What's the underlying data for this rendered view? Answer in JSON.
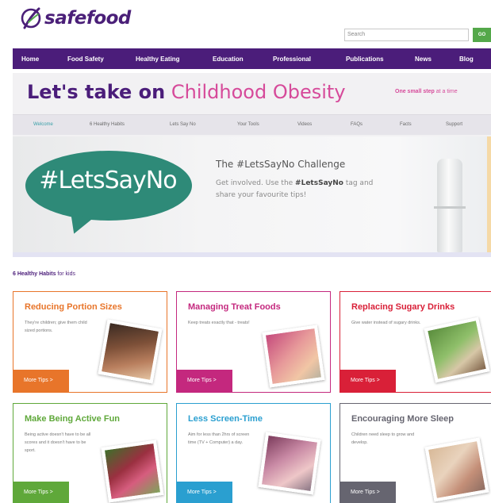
{
  "brand": {
    "name": "safefood"
  },
  "search": {
    "placeholder": "Search",
    "button_label": "GO"
  },
  "nav": {
    "items": [
      {
        "label": "Home"
      },
      {
        "label": "Food Safety"
      },
      {
        "label": "Healthy Eating"
      },
      {
        "label": "Education"
      },
      {
        "label": "Professional"
      },
      {
        "label": "Publications"
      },
      {
        "label": "News"
      },
      {
        "label": "Blog"
      }
    ]
  },
  "campaign": {
    "headline_bold": "Let's take on",
    "headline_accent": "Childhood Obesity",
    "tagline_bold": "One small step",
    "tagline_rest": " at a time"
  },
  "subtabs": [
    {
      "label": "Welcome",
      "active": true
    },
    {
      "label": "6 Healthy Habits"
    },
    {
      "label": "Lets Say No"
    },
    {
      "label": "Your Tools"
    },
    {
      "label": "Videos"
    },
    {
      "label": "FAQs"
    },
    {
      "label": "Facts"
    },
    {
      "label": "Support"
    }
  ],
  "hero": {
    "bubble_text": "#LetsSayNo",
    "title": "The #LetsSayNo Challenge",
    "text_before": "Get involved. Use the ",
    "text_tag": "#LetsSayNo",
    "text_after": " tag and share your favourite tips!"
  },
  "habits": {
    "heading_bold": "6 Healthy Habits",
    "heading_rest": " for kids",
    "cards": [
      {
        "title": "Reducing Portion Sizes",
        "desc": "They're children; give them child sized portions.",
        "button": "More Tips >",
        "color": "#e8752a",
        "photo": "child-eating-photo"
      },
      {
        "title": "Managing Treat Foods",
        "desc": "Keep treats exactly that - treats!",
        "button": "More Tips >",
        "color": "#c4287e",
        "photo": "child-smiling-photo"
      },
      {
        "title": "Replacing Sugary Drinks",
        "desc": "Give water instead of sugary drinks.",
        "button": "More Tips >",
        "color": "#d92038",
        "photo": "child-drinking-photo"
      },
      {
        "title": "Make Being Active Fun",
        "desc": "Being active doesn't have to be all scores and it doesn't have to be sport.",
        "button": "More Tips >",
        "color": "#5fa83a",
        "photo": "child-cycling-photo"
      },
      {
        "title": "Less Screen-Time",
        "desc": "Aim for less than 2hrs of screen time (TV + Computer) a day.",
        "button": "More Tips >",
        "color": "#2a9fd0",
        "photo": "child-screen-photo"
      },
      {
        "title": "Encouraging More Sleep",
        "desc": "Children need sleep to grow and develop.",
        "button": "More Tips >",
        "color": "#666570",
        "photo": "child-sleeping-photo"
      }
    ]
  },
  "colors": {
    "brand_purple": "#4b1d7a",
    "accent_pink": "#d64a9a",
    "go_green": "#54a84a",
    "bubble_teal": "#2e8a78"
  }
}
